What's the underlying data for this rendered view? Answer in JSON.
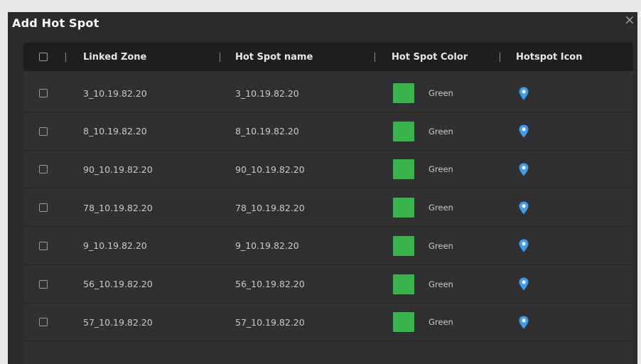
{
  "dialog": {
    "title": "Add Hot Spot",
    "close_glyph": "×"
  },
  "table": {
    "headers": {
      "linked_zone": "Linked Zone",
      "hot_spot_name": "Hot Spot name",
      "hot_spot_color": "Hot Spot Color",
      "hotspot_icon": "Hotspot Icon"
    },
    "rows": [
      {
        "linked_zone": "3_10.19.82.20",
        "name": "3_10.19.82.20",
        "color": "Green",
        "icon": "location-pin-icon"
      },
      {
        "linked_zone": "8_10.19.82.20",
        "name": "8_10.19.82.20",
        "color": "Green",
        "icon": "location-pin-icon"
      },
      {
        "linked_zone": "90_10.19.82.20",
        "name": "90_10.19.82.20",
        "color": "Green",
        "icon": "location-pin-icon"
      },
      {
        "linked_zone": "78_10.19.82.20",
        "name": "78_10.19.82.20",
        "color": "Green",
        "icon": "location-pin-icon"
      },
      {
        "linked_zone": "9_10.19.82.20",
        "name": "9_10.19.82.20",
        "color": "Green",
        "icon": "location-pin-icon"
      },
      {
        "linked_zone": "56_10.19.82.20",
        "name": "56_10.19.82.20",
        "color": "Green",
        "icon": "location-pin-icon"
      },
      {
        "linked_zone": "57_10.19.82.20",
        "name": "57_10.19.82.20",
        "color": "Green",
        "icon": "location-pin-icon"
      }
    ]
  },
  "colors": {
    "dialog_bg": "#2b2b2d",
    "header_bg": "#1e1e20",
    "swatch_green": "#37b34a",
    "pin_blue": "#3e9ce8"
  }
}
